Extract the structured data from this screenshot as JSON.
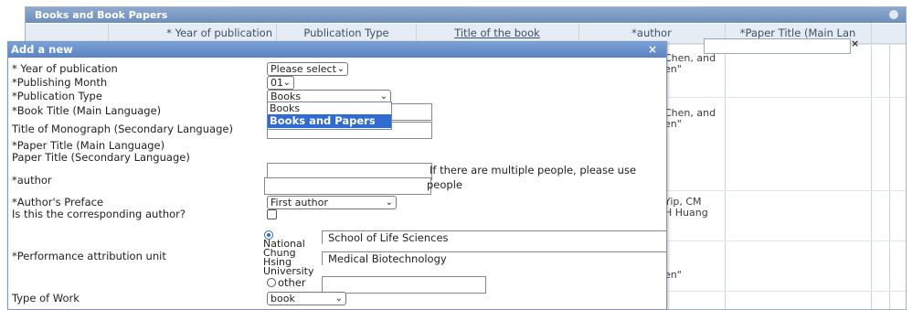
{
  "background": {
    "panel_title": "Books and Book Papers",
    "columns": [
      "* Year of publication",
      "Publication Type",
      "Title of the book",
      "*author",
      "*Paper Title (Main Lan"
    ],
    "filter_clear": "×",
    "cells": [
      "Chen, and\nen\"",
      "Chen, and\nen\"",
      "Yip, CM\nH Huang",
      "en\""
    ]
  },
  "dialog": {
    "title": "Add a new",
    "close": "×",
    "fields": {
      "year_label": "* Year of publication",
      "year_value": "Please select",
      "month_label": "*Publishing Month",
      "month_value": "01",
      "pubtype_label": "*Publication Type",
      "pubtype_value": "Books",
      "pubtype_options": [
        "Books",
        "Books and Papers"
      ],
      "book_title_label": "*Book Title (Main Language)",
      "monograph_label": "Title of Monograph (Secondary Language)",
      "paper_main_label": "*Paper Title (Main Language)",
      "paper_secondary_label": "Paper Title (Secondary Language)",
      "author_label": "*author",
      "author_hint_1": "If there are multiple people, please use",
      "author_hint_2": "people",
      "preface_label": "*Author's Preface",
      "preface_value": "First author",
      "corresponding_label": "Is this the corresponding author?",
      "attribution_label": "*Performance attribution unit",
      "unit_option_1": "National\nChung\nHsing\nUniversity",
      "unit_option_2": "other",
      "unit_college": "School of Life Sciences",
      "unit_department": "Medical Biotechnology",
      "work_type_label": "Type of Work",
      "work_type_value": "book"
    }
  }
}
